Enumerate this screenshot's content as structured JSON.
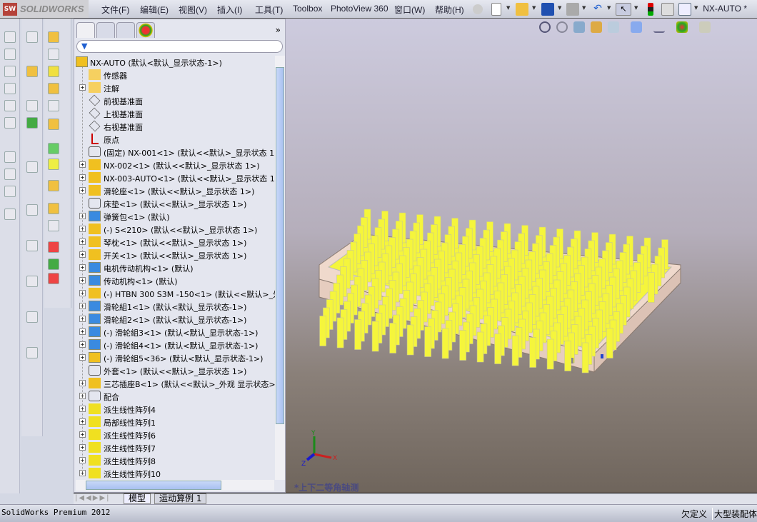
{
  "app": {
    "logo": "SOLIDWORKS",
    "document": "NX-AUTO *"
  },
  "menu": [
    "文件(F)",
    "编辑(E)",
    "视图(V)",
    "插入(I)",
    "工具(T)",
    "Toolbox",
    "PhotoView 360",
    "窗口(W)",
    "帮助(H)"
  ],
  "tree": {
    "items": [
      {
        "label": "NX-AUTO  (默认<默认_显示状态-1>)",
        "icon": "assembly-icon",
        "expand": false
      },
      {
        "label": "传感器",
        "icon": "sensor-folder-icon",
        "expand": false
      },
      {
        "label": "注解",
        "icon": "annotation-folder-icon",
        "expand": true
      },
      {
        "label": "前视基准面",
        "icon": "plane-icon",
        "expand": false
      },
      {
        "label": "上视基准面",
        "icon": "plane-icon",
        "expand": false
      },
      {
        "label": "右视基准面",
        "icon": "plane-icon",
        "expand": false
      },
      {
        "label": "原点",
        "icon": "origin-icon",
        "expand": false
      },
      {
        "label": "(固定) NX-001<1> (默认<<默认>_显示状态 1",
        "icon": "part-outline-icon",
        "expand": false
      },
      {
        "label": "NX-002<1> (默认<<默认>_显示状态 1>)",
        "icon": "part-icon",
        "expand": true
      },
      {
        "label": "NX-003-AUTO<1> (默认<<默认>_显示状态 1>)",
        "icon": "part-icon",
        "expand": true
      },
      {
        "label": "滑轮座<1> (默认<<默认>_显示状态 1>)",
        "icon": "part-icon",
        "expand": true
      },
      {
        "label": "床垫<1> (默认<<默认>_显示状态 1>)",
        "icon": "part-outline-icon",
        "expand": false
      },
      {
        "label": "弹簧包<1> (默认)",
        "icon": "subassembly-icon",
        "expand": true
      },
      {
        "label": "(-) S<210> (默认<<默认>_显示状态 1>)",
        "icon": "part-icon",
        "expand": true
      },
      {
        "label": "琴枕<1> (默认<<默认>_显示状态 1>)",
        "icon": "part-icon",
        "expand": true
      },
      {
        "label": "开关<1> (默认<<默认>_显示状态 1>)",
        "icon": "part-icon",
        "expand": true
      },
      {
        "label": "电机传动机构<1> (默认)",
        "icon": "subassembly-icon",
        "expand": true
      },
      {
        "label": "传动机构<1> (默认)",
        "icon": "subassembly-icon",
        "expand": true
      },
      {
        "label": "(-) HTBN 300 S3M -150<1> (默认<<默认>_外",
        "icon": "part-icon",
        "expand": true
      },
      {
        "label": "滑轮組1<1> (默认<默认_显示状态-1>)",
        "icon": "subassembly-icon",
        "expand": true
      },
      {
        "label": "滑轮組2<1> (默认<默认_显示状态-1>)",
        "icon": "subassembly-icon",
        "expand": true
      },
      {
        "label": "(-) 滑轮組3<1> (默认<默认_显示状态-1>)",
        "icon": "subassembly-icon",
        "expand": true
      },
      {
        "label": "(-) 滑轮組4<1> (默认<默认_显示状态-1>)",
        "icon": "subassembly-icon",
        "expand": true
      },
      {
        "label": "(-) 滑轮組5<36> (默认<默认_显示状态-1>)",
        "icon": "assembly-icon",
        "expand": true
      },
      {
        "label": "外套<1> (默认<<默认>_显示状态 1>)",
        "icon": "part-outline-icon",
        "expand": false
      },
      {
        "label": "三芯插座B<1> (默认<<默认>_外观 显示状态>",
        "icon": "part-icon",
        "expand": true
      },
      {
        "label": "配合",
        "icon": "mates-icon",
        "expand": true
      },
      {
        "label": "派生线性阵列4",
        "icon": "pattern-icon",
        "expand": true
      },
      {
        "label": "局部线性阵列1",
        "icon": "pattern-icon",
        "expand": true
      },
      {
        "label": "派生线性阵列6",
        "icon": "pattern-icon",
        "expand": true
      },
      {
        "label": "派生线性阵列7",
        "icon": "pattern-icon",
        "expand": true
      },
      {
        "label": "派生线性阵列8",
        "icon": "pattern-icon",
        "expand": true
      },
      {
        "label": "派生线性阵列10",
        "icon": "pattern-icon",
        "expand": true
      }
    ]
  },
  "viewport": {
    "view_name": "*上下二等角轴测",
    "axes": {
      "x": "X",
      "y": "Y",
      "z": "Z"
    }
  },
  "bottom_tabs": [
    "模型",
    "运动算例 1"
  ],
  "status": {
    "product": "SolidWorks Premium 2012",
    "state": "欠定义",
    "mode": "大型装配体"
  },
  "colors": {
    "model": "#f5f53c",
    "tray": "#efd9cc"
  }
}
